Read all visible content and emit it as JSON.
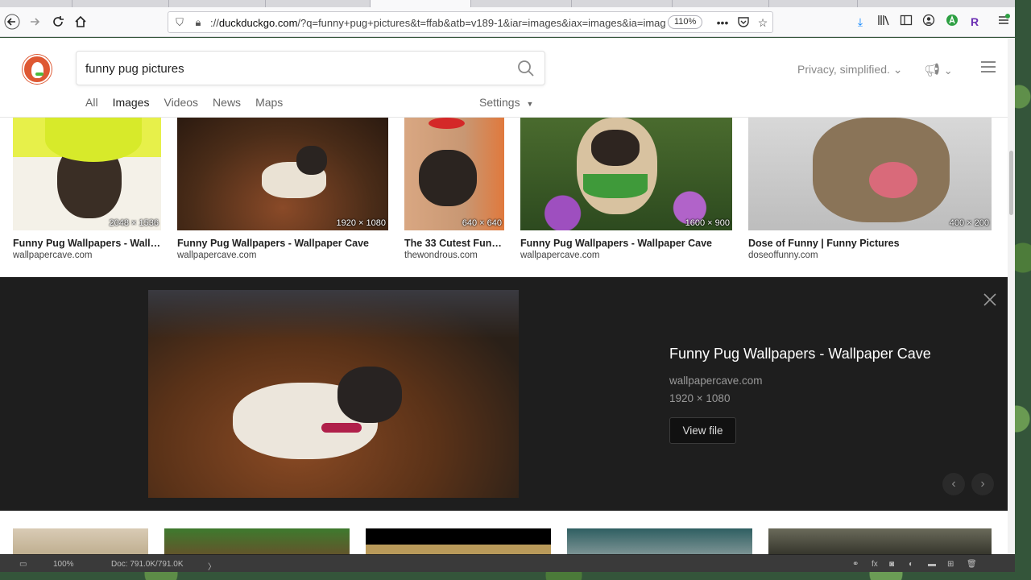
{
  "browser": {
    "url_host": "duckduckgo.com",
    "url_prefix": "://",
    "url_rest": "/?q=funny+pug+pictures&t=ffab&atb=v189-1&iar=images&iax=images&ia=imag",
    "zoom": "110%"
  },
  "search": {
    "query": "funny pug pictures",
    "privacy_label": "Privacy, simplified."
  },
  "nav": {
    "tabs": [
      {
        "label": "All",
        "active": false
      },
      {
        "label": "Images",
        "active": true
      },
      {
        "label": "Videos",
        "active": false
      },
      {
        "label": "News",
        "active": false
      },
      {
        "label": "Maps",
        "active": false
      }
    ],
    "settings_label": "Settings"
  },
  "results": [
    {
      "title": "Funny Pug Wallpapers - Wallp...",
      "source": "wallpapercave.com",
      "dimensions": "2048 × 1536"
    },
    {
      "title": "Funny Pug Wallpapers - Wallpaper Cave",
      "source": "wallpapercave.com",
      "dimensions": "1920 × 1080"
    },
    {
      "title": "The 33 Cutest Funn...",
      "source": "thewondrous.com",
      "dimensions": "640 × 640"
    },
    {
      "title": "Funny Pug Wallpapers - Wallpaper Cave",
      "source": "wallpapercave.com",
      "dimensions": "1600 × 900"
    },
    {
      "title": "Dose of Funny | Funny Pictures",
      "source": "doseoffunny.com",
      "dimensions": "400 × 200"
    }
  ],
  "detail": {
    "title": "Funny Pug Wallpapers - Wallpaper Cave",
    "source": "wallpapercave.com",
    "dimensions": "1920 × 1080",
    "view_file_label": "View file"
  },
  "statusbar": {
    "zoom": "100%",
    "doc": "Doc: 791.0K/791.0K"
  }
}
